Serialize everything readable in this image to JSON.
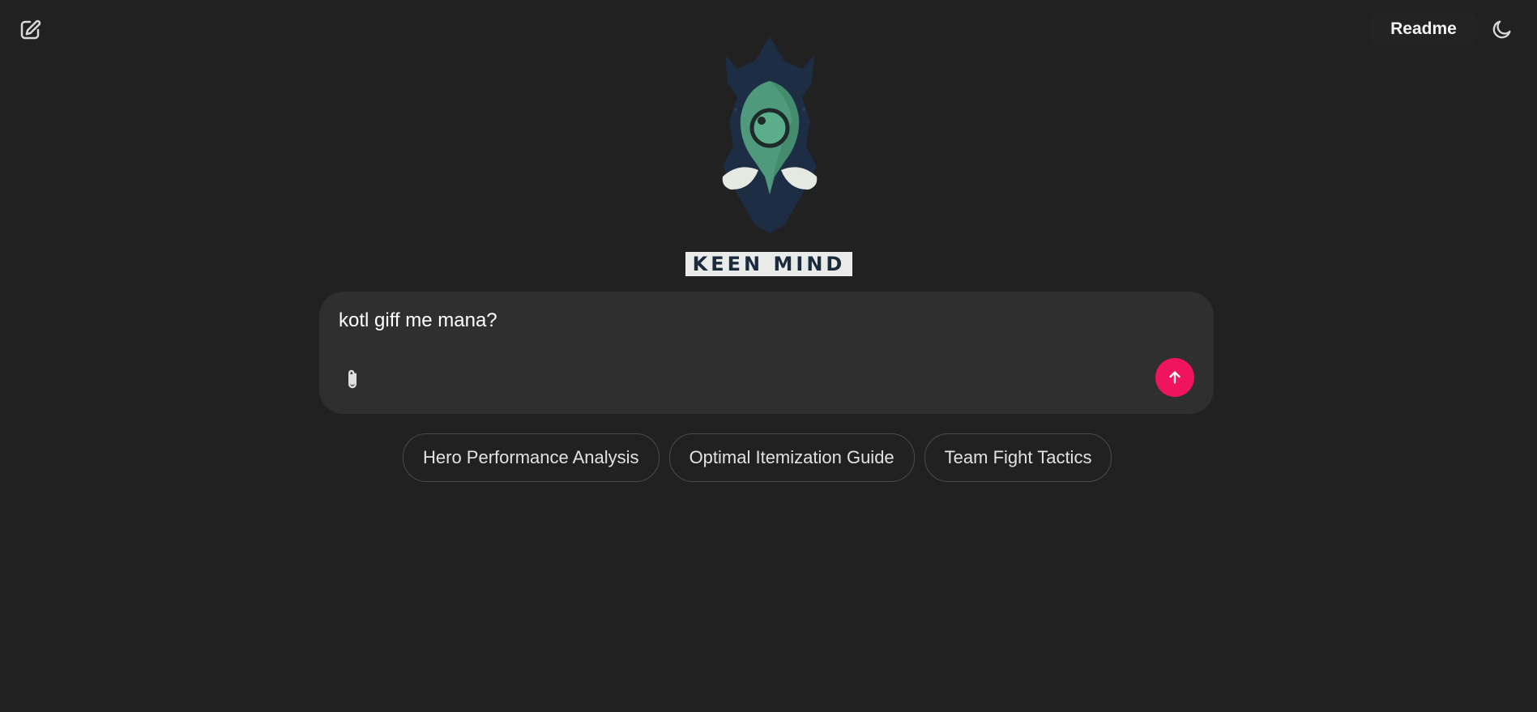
{
  "header": {
    "new_chat_icon": "edit-icon",
    "readme_label": "Readme",
    "theme_icon": "moon-icon"
  },
  "branding": {
    "logo_icon": "keen-mind-mask-icon",
    "wordmark": "KEEN MIND"
  },
  "composer": {
    "value": "kotl giff me mana?",
    "attach_icon": "paperclip-icon",
    "send_icon": "arrow-up-icon",
    "send_color": "#f0135e"
  },
  "suggestions": [
    {
      "label": "Hero Performance Analysis"
    },
    {
      "label": "Optimal Itemization Guide"
    },
    {
      "label": "Team Fight Tactics"
    }
  ],
  "colors": {
    "background": "#212121",
    "composer_bg": "#2f2f2f",
    "accent": "#f0135e"
  }
}
